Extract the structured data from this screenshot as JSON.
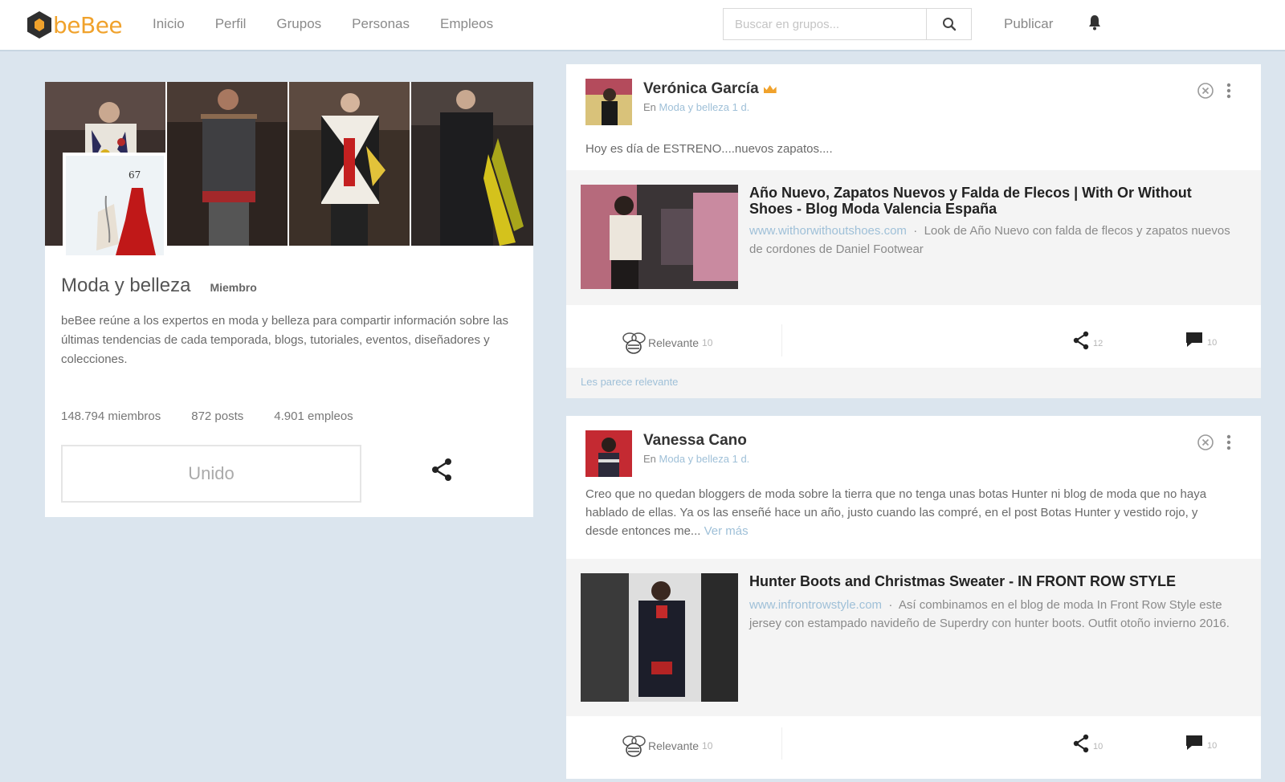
{
  "header": {
    "logo_text": "beBee",
    "nav": [
      "Inicio",
      "Perfil",
      "Grupos",
      "Personas",
      "Empleos"
    ],
    "search_placeholder": "Buscar en grupos...",
    "publish_label": "Publicar"
  },
  "group": {
    "title": "Moda y belleza",
    "member_badge": "Miembro",
    "description": "beBee reúne a los expertos en moda y belleza para compartir información sobre las últimas tendencias de cada temporada, blogs, tutoriales, eventos, diseñadores y colecciones.",
    "stats": {
      "members": "148.794 miembros",
      "posts": "872 posts",
      "jobs": "4.901 empleos"
    },
    "joined_label": "Unido"
  },
  "posts": [
    {
      "author": "Verónica García",
      "meta_prefix": "En",
      "meta_group": "Moda y belleza",
      "meta_time": "1 d.",
      "text": "Hoy es día de ESTRENO....nuevos zapatos....",
      "link": {
        "title": "Año Nuevo, Zapatos Nuevos y Falda de Flecos | With Or Without Shoes - Blog Moda Valencia España",
        "url": "www.withorwithoutshoes.com",
        "summary": "Look de Año Nuevo con falda de flecos y zapatos nuevos de cordones de Daniel Footwear"
      },
      "relevant_label": "Relevante",
      "relevant_count": "10",
      "share_count": "12",
      "comment_count": "10",
      "footer": "Les parece relevante"
    },
    {
      "author": "Vanessa Cano",
      "meta_prefix": "En",
      "meta_group": "Moda y belleza",
      "meta_time": "1 d.",
      "text": "Creo que no quedan bloggers de moda sobre la tierra que no tenga unas botas Hunter ni blog de moda que no haya hablado de ellas. Ya os las enseñé hace un año, justo cuando las compré, en el post Botas Hunter y vestido rojo, y desde entonces me...",
      "see_more": "Ver más",
      "link": {
        "title": "Hunter Boots and Christmas Sweater - IN FRONT ROW STYLE",
        "url": "www.infrontrowstyle.com",
        "summary": "Así combinamos en el blog de moda In Front Row Style este jersey con estampado navideño de Superdry con hunter boots. Outfit otoño invierno 2016."
      },
      "relevant_label": "Relevante",
      "relevant_count": "10",
      "share_count": "10",
      "comment_count": "10"
    }
  ]
}
